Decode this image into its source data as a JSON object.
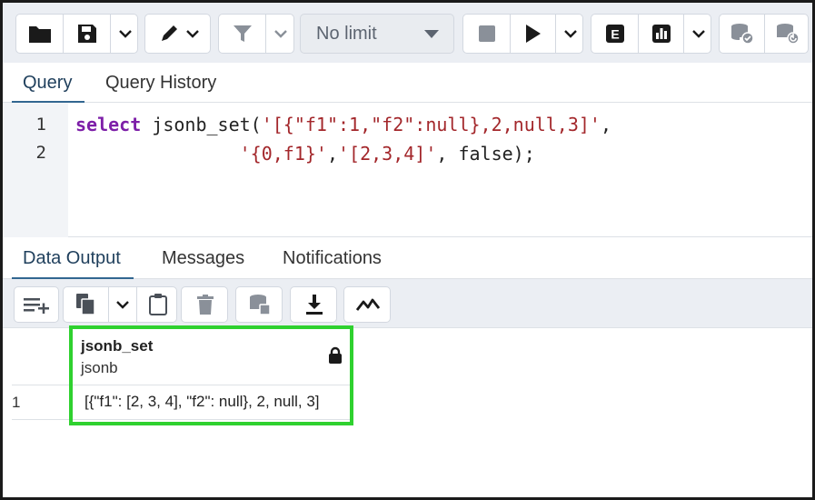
{
  "toolbar": {
    "buttons": [
      {
        "icon": "folder-icon"
      },
      {
        "icon": "save-icon"
      },
      {
        "icon": "chevron-down-icon"
      },
      {
        "icon": "edit-pen-icon"
      },
      {
        "icon": "filter-icon"
      },
      {
        "icon": "chevron-down-icon"
      },
      {
        "icon": "stop-icon"
      },
      {
        "icon": "play-icon"
      },
      {
        "icon": "explain-icon"
      },
      {
        "icon": "explain-analyze-icon"
      },
      {
        "icon": "commit-icon"
      },
      {
        "icon": "rollback-icon"
      }
    ],
    "limit_label": "No limit",
    "explain_letter": "E"
  },
  "query_tabs": [
    "Query",
    "Query History"
  ],
  "editor": {
    "line_numbers": [
      "1",
      "2"
    ],
    "line1": {
      "kw": "select",
      "fn": " jsonb_set(",
      "s1": "'[{\"f1\":1,\"f2\":null},2,null,3]'",
      "tail": ","
    },
    "line2": {
      "indent": "               ",
      "s2": "'{0,f1}'",
      "comma": ",",
      "s3": "'[2,3,4]'",
      "tail": ", false);"
    }
  },
  "result_tabs": [
    "Data Output",
    "Messages",
    "Notifications"
  ],
  "grid": {
    "column": {
      "name": "jsonb_set",
      "type": "jsonb"
    },
    "rows": [
      {
        "num": "1",
        "value": "[{\"f1\": [2, 3, 4], \"f2\": null}, 2, null, 3]"
      }
    ]
  },
  "colors": {
    "accent_tab": "#326690",
    "highlight": "#2fd12f",
    "keyword": "#7d1fa8",
    "string": "#a3272b"
  }
}
